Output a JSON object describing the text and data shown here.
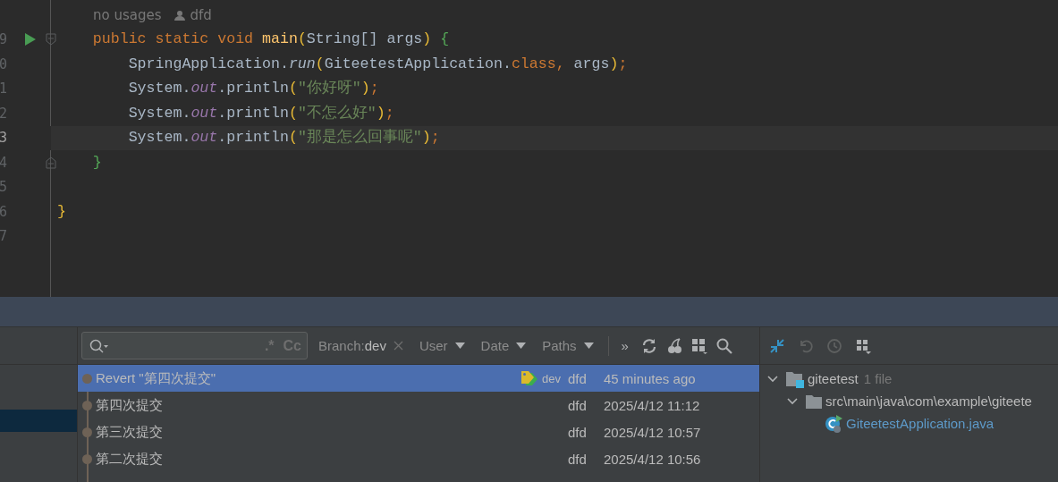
{
  "editor": {
    "hint": {
      "usages": "no usages",
      "author": "dfd"
    },
    "lines": [
      {
        "number": "9",
        "run": true,
        "fold_start": true,
        "current": false,
        "tokens": [
          {
            "text": "    public static void ",
            "kind": "keyword"
          },
          {
            "text": "main",
            "kind": "decl"
          },
          {
            "text": "(",
            "kind": "paren"
          },
          {
            "text": "String[] args",
            "kind": "plain"
          },
          {
            "text": ")",
            "kind": "paren"
          },
          {
            "text": " {",
            "kind": "brace"
          }
        ]
      },
      {
        "number": "0",
        "current": false,
        "tokens": [
          {
            "text": "        SpringApplication.",
            "kind": "plain"
          },
          {
            "text": "run",
            "kind": "call"
          },
          {
            "text": "(",
            "kind": "paren"
          },
          {
            "text": "GiteetestApplication.",
            "kind": "plain"
          },
          {
            "text": "class",
            "kind": "keyword"
          },
          {
            "text": ", ",
            "kind": "keyword"
          },
          {
            "text": "args",
            "kind": "plain"
          },
          {
            "text": ")",
            "kind": "paren"
          },
          {
            "text": ";",
            "kind": "keyword"
          }
        ]
      },
      {
        "number": "1",
        "current": false,
        "tokens": [
          {
            "text": "        System.",
            "kind": "plain"
          },
          {
            "text": "out",
            "kind": "field"
          },
          {
            "text": ".println",
            "kind": "plain"
          },
          {
            "text": "(",
            "kind": "paren"
          },
          {
            "text": "\"你好呀\"",
            "kind": "string"
          },
          {
            "text": ")",
            "kind": "paren"
          },
          {
            "text": ";",
            "kind": "keyword"
          }
        ]
      },
      {
        "number": "2",
        "current": false,
        "tokens": [
          {
            "text": "        System.",
            "kind": "plain"
          },
          {
            "text": "out",
            "kind": "field"
          },
          {
            "text": ".println",
            "kind": "plain"
          },
          {
            "text": "(",
            "kind": "paren"
          },
          {
            "text": "\"不怎么好\"",
            "kind": "string"
          },
          {
            "text": ")",
            "kind": "paren"
          },
          {
            "text": ";",
            "kind": "keyword"
          }
        ]
      },
      {
        "number": "3",
        "current": true,
        "tokens": [
          {
            "text": "        System.",
            "kind": "plain"
          },
          {
            "text": "out",
            "kind": "field"
          },
          {
            "text": ".println",
            "kind": "plain"
          },
          {
            "text": "(",
            "kind": "paren"
          },
          {
            "text": "\"那是怎么回事呢\"",
            "kind": "string"
          },
          {
            "text": ")",
            "kind": "paren"
          },
          {
            "text": ";",
            "kind": "keyword"
          }
        ]
      },
      {
        "number": "4",
        "fold_end": true,
        "current": false,
        "tokens": [
          {
            "text": "    }",
            "kind": "brace"
          }
        ]
      },
      {
        "number": "5",
        "current": false
      },
      {
        "number": "6",
        "current": false,
        "tokens": [
          {
            "text": "}",
            "kind": "paren"
          }
        ]
      },
      {
        "number": "7",
        "current": false
      }
    ]
  },
  "log": {
    "search": {
      "regex": ".*",
      "case": "Cc"
    },
    "filters": [
      {
        "label": "Branch: ",
        "value": "dev",
        "kind": "branch"
      },
      {
        "label": "User",
        "kind": "menu"
      },
      {
        "label": "Date",
        "kind": "menu"
      },
      {
        "label": "Paths",
        "kind": "menu"
      }
    ],
    "more": "»",
    "commits": [
      {
        "message": "Revert \"第四次提交\"",
        "tag": "dev",
        "author": "dfd",
        "date": "45 minutes ago",
        "selected": true
      },
      {
        "message": "第四次提交",
        "author": "dfd",
        "date": "2025/4/12 11:12",
        "selected": false
      },
      {
        "message": "第三次提交",
        "author": "dfd",
        "date": "2025/4/12 10:57",
        "selected": false
      },
      {
        "message": "第二次提交",
        "author": "dfd",
        "date": "2025/4/12 10:56",
        "selected": false
      }
    ]
  },
  "changes": {
    "tree": [
      {
        "name": "giteetest",
        "count": "1 file",
        "kind": "module",
        "expanded": true,
        "children": [
          {
            "name": "src\\main\\java\\com\\example\\giteete",
            "kind": "folder",
            "expanded": true,
            "children": [
              {
                "name": "GiteetestApplication.java",
                "kind": "file"
              }
            ]
          }
        ]
      }
    ]
  }
}
